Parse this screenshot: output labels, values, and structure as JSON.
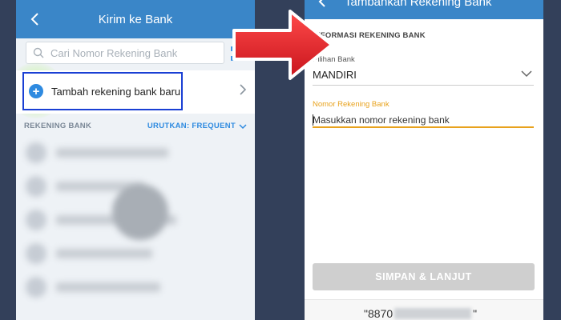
{
  "left": {
    "title": "Kirim ke Bank",
    "search_placeholder": "Cari Nomor Rekening Bank",
    "add_button_label": "Tambah rekening bank baru",
    "section_label": "REKENING BANK",
    "sort_label": "URUTKAN: FREQUENT"
  },
  "right": {
    "title": "Tambahkan Rekening Bank",
    "section_title": "INFORMASI REKENING BANK",
    "bank_label": "Pilihan Bank",
    "bank_value": "MANDIRI",
    "account_label": "Nomor Rekening Bank",
    "account_placeholder": "Masukkan nomor rekening bank",
    "save_button": "SIMPAN & LANJUT",
    "account_preview_prefix": "\"8870",
    "account_preview_suffix": "\""
  },
  "colors": {
    "header_blue": "#3a86c8",
    "accent_blue": "#2e8ae0",
    "highlight_border": "#1a3fd4",
    "input_active": "#e8a21d",
    "disabled_button": "#cfcfcf",
    "arrow_red": "#e8202a",
    "background": "#33405a"
  },
  "icons": {
    "back": "back-arrow-icon",
    "search": "search-icon",
    "scan": "scan-icon",
    "plus": "plus-circle-icon",
    "chevron_right": "chevron-right-icon",
    "chevron_down": "chevron-down-icon",
    "pointer_arrow": "red-arrow-icon"
  }
}
